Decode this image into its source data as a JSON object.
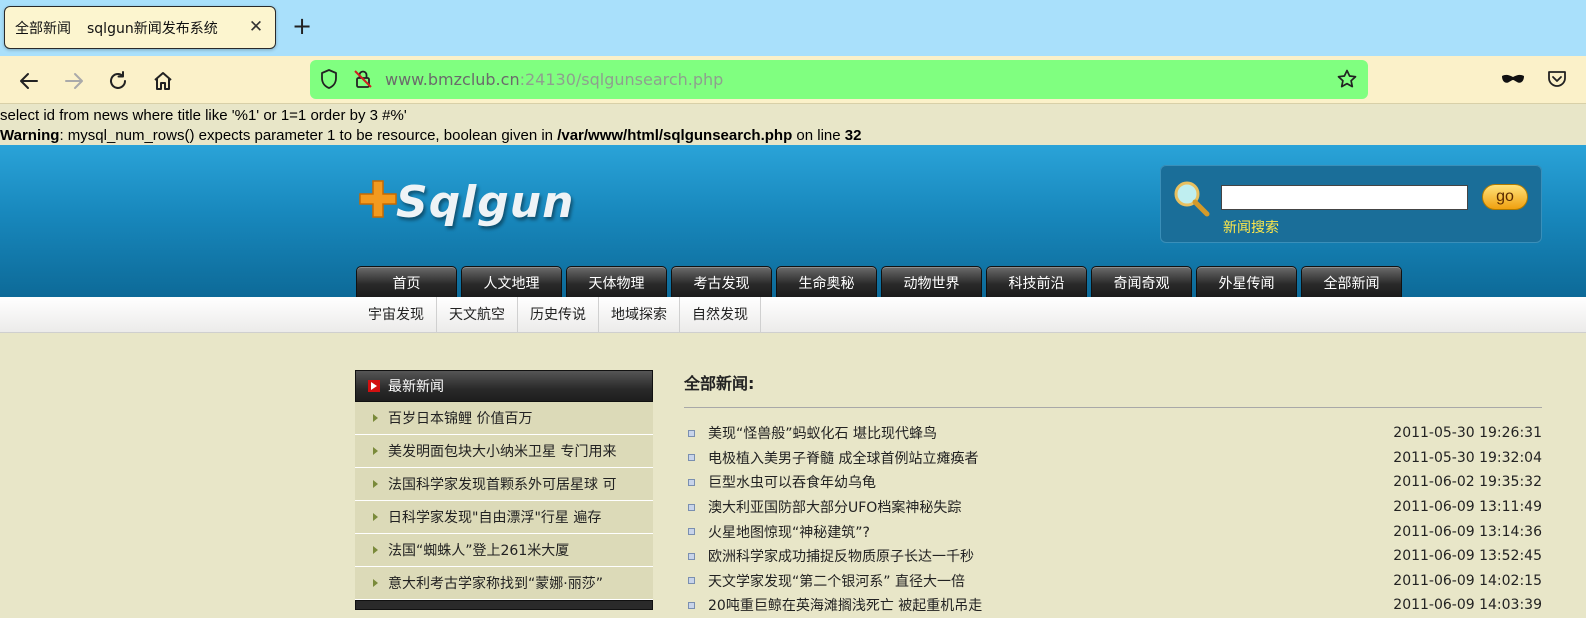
{
  "browser": {
    "tab_title_1": "全部新闻",
    "tab_title_2": "sqlgun新闻发布系统",
    "close_glyph": "✕",
    "newtab_glyph": "+",
    "url_host": "www.bmzclub.cn",
    "url_port": ":24130",
    "url_path": "/sqlgunsearch.php"
  },
  "debug": {
    "query": "select id from news where title like '%1' or 1=1 order by 3 #%'",
    "warning_label": "Warning",
    "warning_text": ": mysql_num_rows() expects parameter 1 to be resource, boolean given in ",
    "warning_file": "/var/www/html/sqlgunsearch.php",
    "warning_online": " on line ",
    "warning_line": "32"
  },
  "header": {
    "logo_text": "Sqlgun",
    "search_button": "go",
    "search_label": "新闻搜索",
    "search_value": ""
  },
  "nav": {
    "main": [
      "首页",
      "人文地理",
      "天体物理",
      "考古发现",
      "生命奥秘",
      "动物世界",
      "科技前沿",
      "奇闻奇观",
      "外星传闻",
      "全部新闻"
    ],
    "sub": [
      "宇宙发现",
      "天文航空",
      "历史传说",
      "地域探索",
      "自然发现"
    ]
  },
  "sidebar": {
    "title": "最新新闻",
    "items": [
      "百岁日本锦鲤 价值百万",
      "美发明面包块大小纳米卫星 专门用来",
      "法国科学家发现首颗系外可居星球 可",
      "日科学家发现\"自由漂浮\"行星 遍存",
      "法国“蜘蛛人”登上261米大厦",
      "意大利考古学家称找到“蒙娜·丽莎”"
    ]
  },
  "main": {
    "title": "全部新闻:",
    "news": [
      {
        "title": "美现“怪兽般”蚂蚁化石 堪比现代蜂鸟",
        "date": "2011-05-30 19:26:31"
      },
      {
        "title": "电极植入美男子脊髓 成全球首例站立瘫痪者",
        "date": "2011-05-30 19:32:04"
      },
      {
        "title": "巨型水虫可以吞食年幼乌龟",
        "date": "2011-06-02 19:35:32"
      },
      {
        "title": "澳大利亚国防部大部分UFO档案神秘失踪",
        "date": "2011-06-09 13:11:49"
      },
      {
        "title": "火星地图惊现“神秘建筑”?",
        "date": "2011-06-09 13:14:36"
      },
      {
        "title": "欧洲科学家成功捕捉反物质原子长达一千秒",
        "date": "2011-06-09 13:52:45"
      },
      {
        "title": "天文学家发现“第二个银河系” 直径大一倍",
        "date": "2011-06-09 14:02:15"
      },
      {
        "title": "20吨重巨鲸在英海滩搁浅死亡 被起重机吊走",
        "date": "2011-06-09 14:03:39"
      }
    ]
  }
}
